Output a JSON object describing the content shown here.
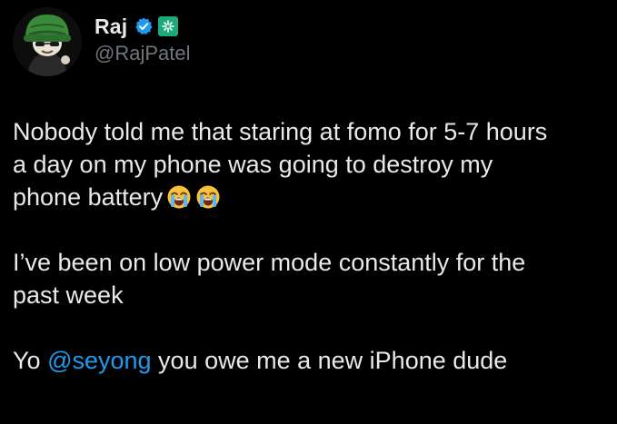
{
  "author": {
    "display_name": "Raj",
    "handle": "@RajPatel",
    "verified_color": "#1d9bf0",
    "affiliate_badge_color": "#1ea97c",
    "avatar_icon": "cartoon-avatar-icon"
  },
  "tweet": {
    "paragraphs": [
      {
        "lines": [
          "Nobody told me that staring at fomo for 5-7 hours",
          "a day on my phone was going to destroy my",
          "phone battery"
        ],
        "trailing_emoji": [
          "loudly-crying-face-icon",
          "loudly-crying-face-icon"
        ]
      },
      {
        "lines": [
          "I’ve been on low power mode constantly for the",
          "past week"
        ]
      },
      {
        "prefix": "Yo ",
        "mention": "@seyong",
        "suffix": " you owe me a new iPhone dude"
      }
    ]
  },
  "colors": {
    "background": "#000000",
    "text": "#e7e9ea",
    "secondary_text": "#71767b",
    "link": "#1d9bf0"
  }
}
